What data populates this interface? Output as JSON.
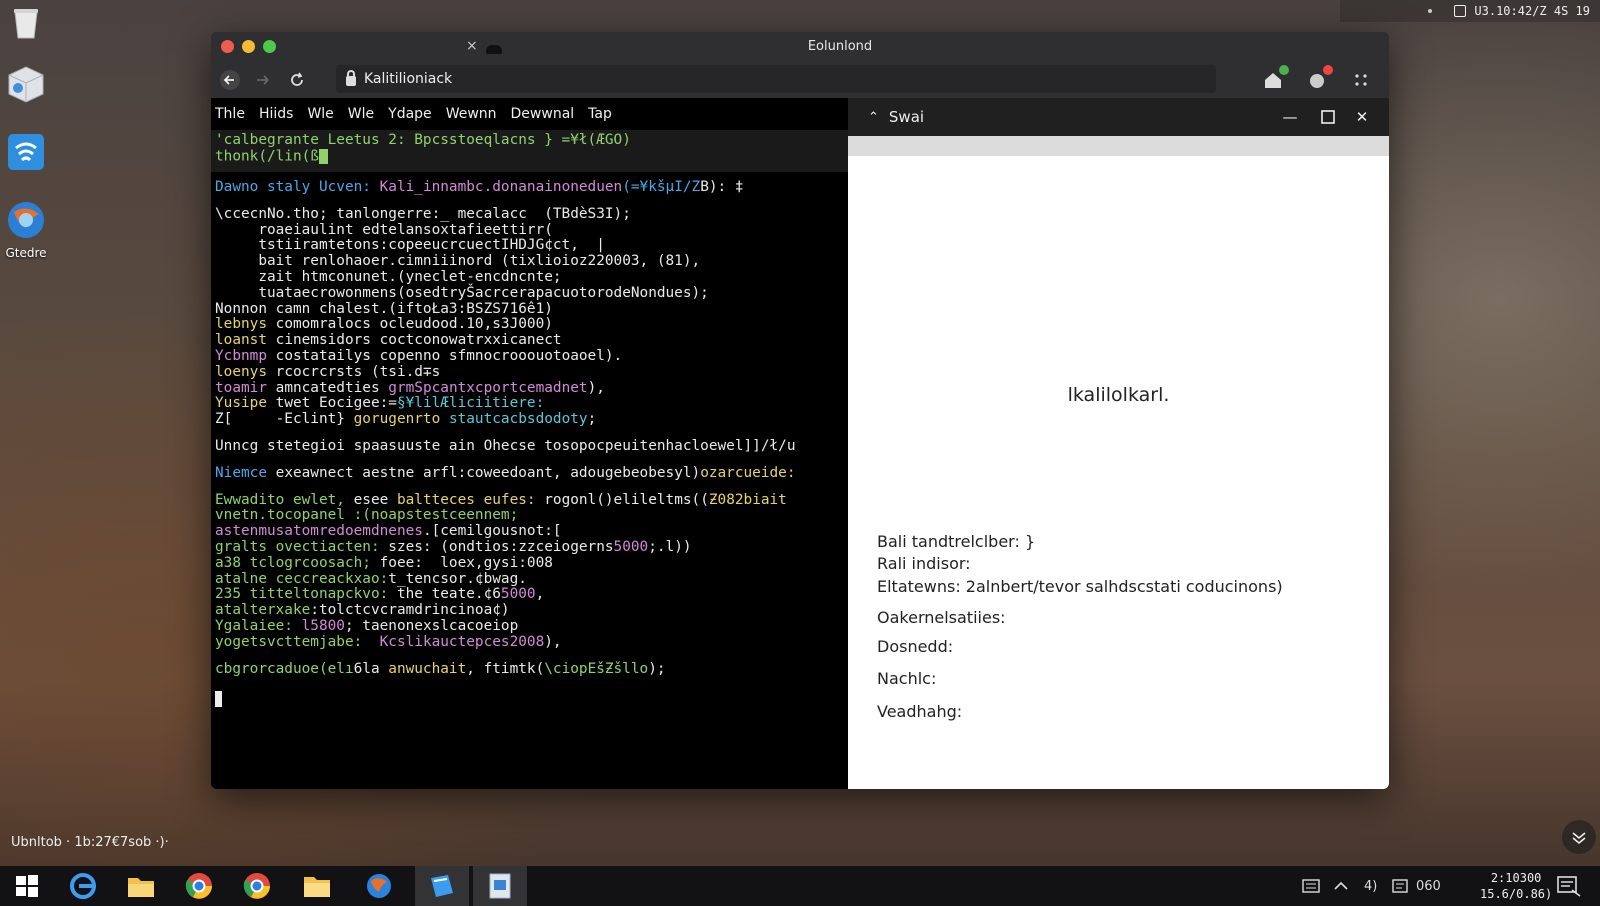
{
  "topbar": {
    "clock": "U3.10:42/Z 4S 19"
  },
  "desktop": {
    "icons": [
      {
        "name": "recycle-bin",
        "label": ""
      },
      {
        "name": "box",
        "label": ""
      },
      {
        "name": "wifi",
        "label": ""
      },
      {
        "name": "globe",
        "label": "Gtedre"
      }
    ],
    "host_label": "Ubn​ltob · 1b:27€7sob ·)·"
  },
  "browser": {
    "title": "Eolunlond",
    "url": "Kalitilioniack",
    "colors": {
      "close": "#ee5b52",
      "minimize": "#f6bb30",
      "maximize": "#4cc94a"
    }
  },
  "terminal": {
    "menu": [
      "Thle",
      "Hiids",
      "Wle",
      "Wle",
      "Ydape",
      "Wewnn",
      "Dewwnal",
      "Tap"
    ],
    "header_line1": "'calbegrante Leetus 2: Bpcsstoeqlacns } =¥ł(ÆGO)",
    "header_line2": "thonk(/lin(ß",
    "lines": [
      {
        "cls": "tl-b",
        "parts": [
          [
            "tl-b",
            "Dawno staly Ucven: "
          ],
          [
            "tl-m",
            "Kali_innambc.donanainoneduen"
          ],
          [
            "tl-b",
            "(=¥kšµI/Z"
          ],
          [
            "tl-w",
            "B): ‡"
          ]
        ]
      },
      {
        "gap": true
      },
      {
        "parts": [
          [
            "tl-w",
            "\\ccecnNo.tho; tanlongerre:_ mecalacc  (TBdèS3I);"
          ]
        ]
      },
      {
        "parts": [
          [
            "tl-w",
            "     roaeiaulint edtelansoxtafieettirr("
          ]
        ]
      },
      {
        "parts": [
          [
            "tl-w",
            "     tstiiramtetons:copeeucrcuectIHDJG¢ct,  |"
          ]
        ]
      },
      {
        "parts": [
          [
            "tl-w",
            "     bait renlohaoer.cimniiinord (tixlioioz220003, (81),"
          ]
        ]
      },
      {
        "parts": [
          [
            "tl-w",
            "     zait htmconunet.(yneclet-encdncnte;"
          ]
        ]
      },
      {
        "parts": [
          [
            "tl-w",
            "     tuataecrowonmens(osedtryŠacrcerapacuotorodeNondues);"
          ]
        ]
      },
      {
        "parts": [
          [
            "tl-w",
            "Nonnon camn chalest.(iftoŁa3:BSZS716ê1)"
          ]
        ]
      },
      {
        "parts": [
          [
            "tl-y",
            "lebnys "
          ],
          [
            "tl-w",
            "comomralocs ocleudood.10,s3J000)"
          ]
        ]
      },
      {
        "parts": [
          [
            "tl-y",
            "loanst "
          ],
          [
            "tl-w",
            "cinemsidors coctconowatrxxicanect"
          ]
        ]
      },
      {
        "parts": [
          [
            "tl-m",
            "Ycbnmp "
          ],
          [
            "tl-w",
            "costatailys copenno sfmnocrooouotoaoel)."
          ]
        ]
      },
      {
        "parts": [
          [
            "tl-y",
            "loenys "
          ],
          [
            "tl-w",
            "rcocrcrsts (tsi.d∓s"
          ]
        ]
      },
      {
        "parts": [
          [
            "tl-m",
            "toamir "
          ],
          [
            "tl-w",
            "amncatedties "
          ],
          [
            "tl-m",
            "grmSpcantxcportcemadnet"
          ],
          [
            "tl-w",
            "),"
          ]
        ]
      },
      {
        "parts": [
          [
            "tl-y",
            "Yusipe "
          ],
          [
            "tl-w",
            "twet Eocigee:="
          ],
          [
            "tl-c",
            "§¥lilÆliciitiere:"
          ]
        ]
      },
      {
        "parts": [
          [
            "tl-w",
            "Z["
          ],
          [
            "tl-w",
            "     -Eclint} "
          ],
          [
            "tl-y",
            "gorugenrto "
          ],
          [
            "tl-c",
            "stautcacbsdodoty"
          ],
          [
            "tl-w",
            ";"
          ]
        ]
      },
      {
        "gap": true
      },
      {
        "parts": [
          [
            "tl-w",
            "Unncg stetegioi spaasuuste ain Ohecse tosopocpeuitenhacloewel]]/ł/u"
          ]
        ]
      },
      {
        "gap": true
      },
      {
        "parts": [
          [
            "tl-b",
            "Niemce "
          ],
          [
            "tl-w",
            "exeawnect aestne arfl:coweedoant, adougebeobesyl)"
          ],
          [
            "tl-y",
            "ozarcueide:"
          ]
        ]
      },
      {
        "gap": true
      },
      {
        "parts": [
          [
            "tl-g",
            "Ewwadito ewlet, "
          ],
          [
            "tl-w",
            "esee "
          ],
          [
            "tl-y",
            "baltteces eufes: "
          ],
          [
            "tl-w",
            "rogonl()elileltms(("
          ],
          [
            "tl-y",
            "Ƶ082biait"
          ]
        ]
      },
      {
        "parts": [
          [
            "tl-g",
            "vnetn.tocopanel :(noapstestceennem;"
          ]
        ]
      },
      {
        "parts": [
          [
            "tl-m",
            "astenmusatomredoemdnenes"
          ],
          [
            "tl-w",
            ".[cemilgousnot:"
          ],
          [
            "tl-w",
            "["
          ]
        ]
      },
      {
        "parts": [
          [
            "tl-g",
            "gralts ovectiacten: "
          ],
          [
            "tl-w",
            "szes: (ondtios:zzceiogerns"
          ],
          [
            "tl-m",
            "5000"
          ],
          [
            "tl-w",
            ";.l))"
          ]
        ]
      },
      {
        "parts": [
          [
            "tl-g",
            "a38 tclogrcoosach; "
          ],
          [
            "tl-w",
            "foee:  loex,gysi:008"
          ]
        ]
      },
      {
        "parts": [
          [
            "tl-g",
            "atalne ceccreackxao:"
          ],
          [
            "tl-w",
            "t_tencsor.¢bwag."
          ]
        ]
      },
      {
        "parts": [
          [
            "tl-g",
            "235 titteltonapckvo: "
          ],
          [
            "tl-w",
            "the teate.¢6"
          ],
          [
            "tl-m",
            "5000"
          ],
          [
            "tl-w",
            ","
          ]
        ]
      },
      {
        "parts": [
          [
            "tl-g",
            "atalterxake"
          ],
          [
            "tl-w",
            ":tolctcvcramdrincinoa¢)"
          ]
        ]
      },
      {
        "parts": [
          [
            "tl-g",
            "Ygalaiee: "
          ],
          [
            "tl-m",
            "l5800"
          ],
          [
            "tl-w",
            "; taenonexslcacoeiop"
          ]
        ]
      },
      {
        "parts": [
          [
            "tl-g",
            "yogetsvcttemjabe:  "
          ],
          [
            "tl-m",
            "Kcslikauctepces2008"
          ],
          [
            "tl-w",
            "),"
          ]
        ]
      },
      {
        "gap": true
      },
      {
        "parts": [
          [
            "tl-g",
            "cbgrorcaduoe(elı"
          ],
          [
            "tl-w",
            "6la "
          ],
          [
            "tl-y",
            "anwuchait"
          ],
          [
            "tl-w",
            ", ftimtk("
          ],
          [
            "tl-g",
            "\\ciopEšƵšllo"
          ],
          [
            "tl-w",
            ");"
          ]
        ]
      }
    ]
  },
  "panel": {
    "title": "Swai",
    "center_text": "lkalilolkarl.",
    "rows": [
      "Bali tandtrelclber:  }",
      "Rali indisor:",
      "Eltatewns:  2alnbert/tevor salhdscstati coducinons)",
      "Oakernelsatiies:",
      "Dosnedd:",
      "Nachlc:",
      "Veadhahg:"
    ]
  },
  "taskbar": {
    "tray_speaker_text": "4)",
    "tray_text": "060",
    "time_line1": "2:10300",
    "time_line2": "15.6/0.86)"
  }
}
